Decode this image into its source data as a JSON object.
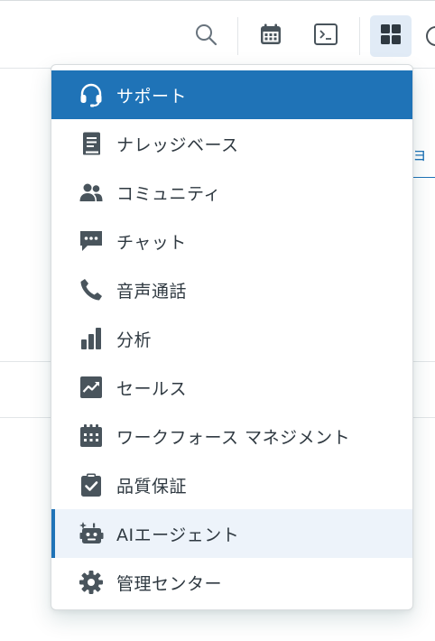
{
  "colors": {
    "accent": "#1f73b7",
    "icon": "#49545c",
    "text": "#2f3941",
    "highlight_bg": "#edf3fa"
  },
  "topbar": {
    "icons": [
      "search-icon",
      "calendar-icon",
      "terminal-icon",
      "apps-grid-icon"
    ]
  },
  "background": {
    "partial_text": "ョ"
  },
  "menu": {
    "items": [
      {
        "label": "サポート",
        "icon": "headset-icon"
      },
      {
        "label": "ナレッジベース",
        "icon": "book-icon"
      },
      {
        "label": "コミュニティ",
        "icon": "people-icon"
      },
      {
        "label": "チャット",
        "icon": "chat-icon"
      },
      {
        "label": "音声通話",
        "icon": "phone-icon"
      },
      {
        "label": "分析",
        "icon": "bar-chart-icon"
      },
      {
        "label": "セールス",
        "icon": "trend-chart-icon"
      },
      {
        "label": "ワークフォース マネジメント",
        "icon": "workforce-calendar-icon"
      },
      {
        "label": "品質保証",
        "icon": "clipboard-check-icon"
      },
      {
        "label": "AIエージェント",
        "icon": "ai-robot-icon"
      },
      {
        "label": "管理センター",
        "icon": "gear-icon"
      }
    ]
  }
}
